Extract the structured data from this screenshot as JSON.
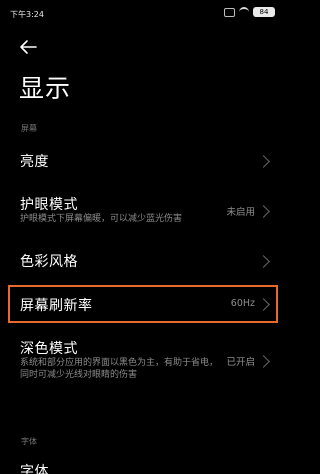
{
  "status_bar": {
    "time": "下午3:24",
    "battery": "84"
  },
  "page": {
    "title": "显示"
  },
  "sections": {
    "screen_label": "屏幕",
    "font_label": "字体"
  },
  "rows": {
    "brightness": {
      "title": "亮度"
    },
    "eye_care": {
      "title": "护眼模式",
      "subtitle": "护眼模式下屏幕偏暖，可以减少蓝光伤害",
      "value": "未启用"
    },
    "color_style": {
      "title": "色彩风格"
    },
    "refresh_rate": {
      "title": "屏幕刷新率",
      "value": "60Hz"
    },
    "dark_mode": {
      "title": "深色模式",
      "subtitle": "系统和部分应用的界面以黑色为主，有助于省电，同时可减少光线对眼睛的伤害",
      "value": "已开启"
    },
    "font_row": {
      "title": "字体"
    }
  },
  "colors": {
    "highlight": "#e86a2a",
    "background": "#000000"
  },
  "icons": [
    "back-arrow-icon",
    "chevron-right-icon",
    "wifi-icon",
    "battery-icon"
  ]
}
